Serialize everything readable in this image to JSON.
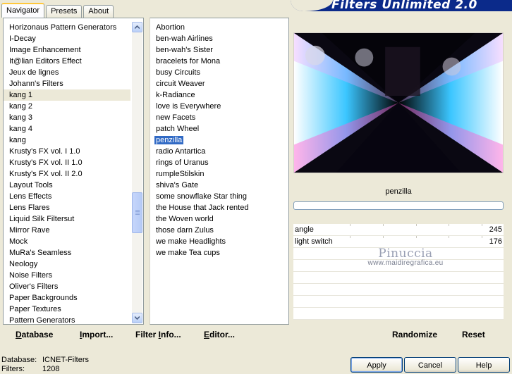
{
  "tabs": [
    {
      "label": "Navigator",
      "active": true
    },
    {
      "label": "Presets",
      "active": false
    },
    {
      "label": "About",
      "active": false
    }
  ],
  "banner": {
    "title": "Filters Unlimited 2.0"
  },
  "categories": {
    "selected": "kang 1",
    "items": [
      "Horizonaus Pattern Generators",
      "I-Decay",
      "Image Enhancement",
      "It@lian Editors Effect",
      "Jeux de lignes",
      "Johann's Filters",
      "kang 1",
      "kang 2",
      "kang 3",
      "kang 4",
      "kang",
      "Krusty's FX vol. I 1.0",
      "Krusty's FX vol. II 1.0",
      "Krusty's FX vol. II 2.0",
      "Layout Tools",
      "Lens Effects",
      "Lens Flares",
      "Liquid Silk Filtersut",
      "Mirror Rave",
      "Mock",
      "MuRa's Seamless",
      "Neology",
      "Noise Filters",
      "Oliver's Filters",
      "Paper Backgrounds",
      "Paper Textures",
      "Pattern Generators"
    ]
  },
  "filters": {
    "selected": "penzilla",
    "items": [
      "Abortion",
      "ben-wah Airlines",
      "ben-wah's Sister",
      "bracelets for Mona",
      "busy Circuits",
      "circuit Weaver",
      "k-Radiance",
      "love is Everywhere",
      "new Facets",
      "patch Wheel",
      "penzilla",
      "radio Antartica",
      "rings of Uranus",
      "rumpleStilskin",
      "shiva's Gate",
      "some snowflake Star thing",
      "the House that Jack rented",
      "the Woven world",
      "those darn Zulus",
      "we make Headlights",
      "we make Tea cups"
    ]
  },
  "preview": {
    "filter_name": "penzilla",
    "progress": 0
  },
  "params": [
    {
      "label": "angle",
      "value": "245"
    },
    {
      "label": "light switch",
      "value": "176"
    }
  ],
  "watermark": {
    "name": "Pinuccia",
    "url": "www.maidiregrafica.eu"
  },
  "toolbar": {
    "database": {
      "u": "D",
      "rest": "atabase"
    },
    "import": {
      "u": "I",
      "rest": "mport..."
    },
    "filter_info": {
      "pre": "Filter ",
      "u": "I",
      "rest": "nfo..."
    },
    "editor": {
      "u": "E",
      "rest": "ditor..."
    },
    "randomize": "Randomize",
    "reset": "Reset"
  },
  "status": {
    "database_label": "Database:",
    "database_value": "ICNET-Filters",
    "filters_label": "Filters:",
    "filters_value": "1208"
  },
  "buttons": {
    "apply": "Apply",
    "cancel": "Cancel",
    "help": "Help"
  },
  "colors": {
    "selection": "#316ac5",
    "banner": "#0b2a8a",
    "face": "#ece9d8"
  }
}
